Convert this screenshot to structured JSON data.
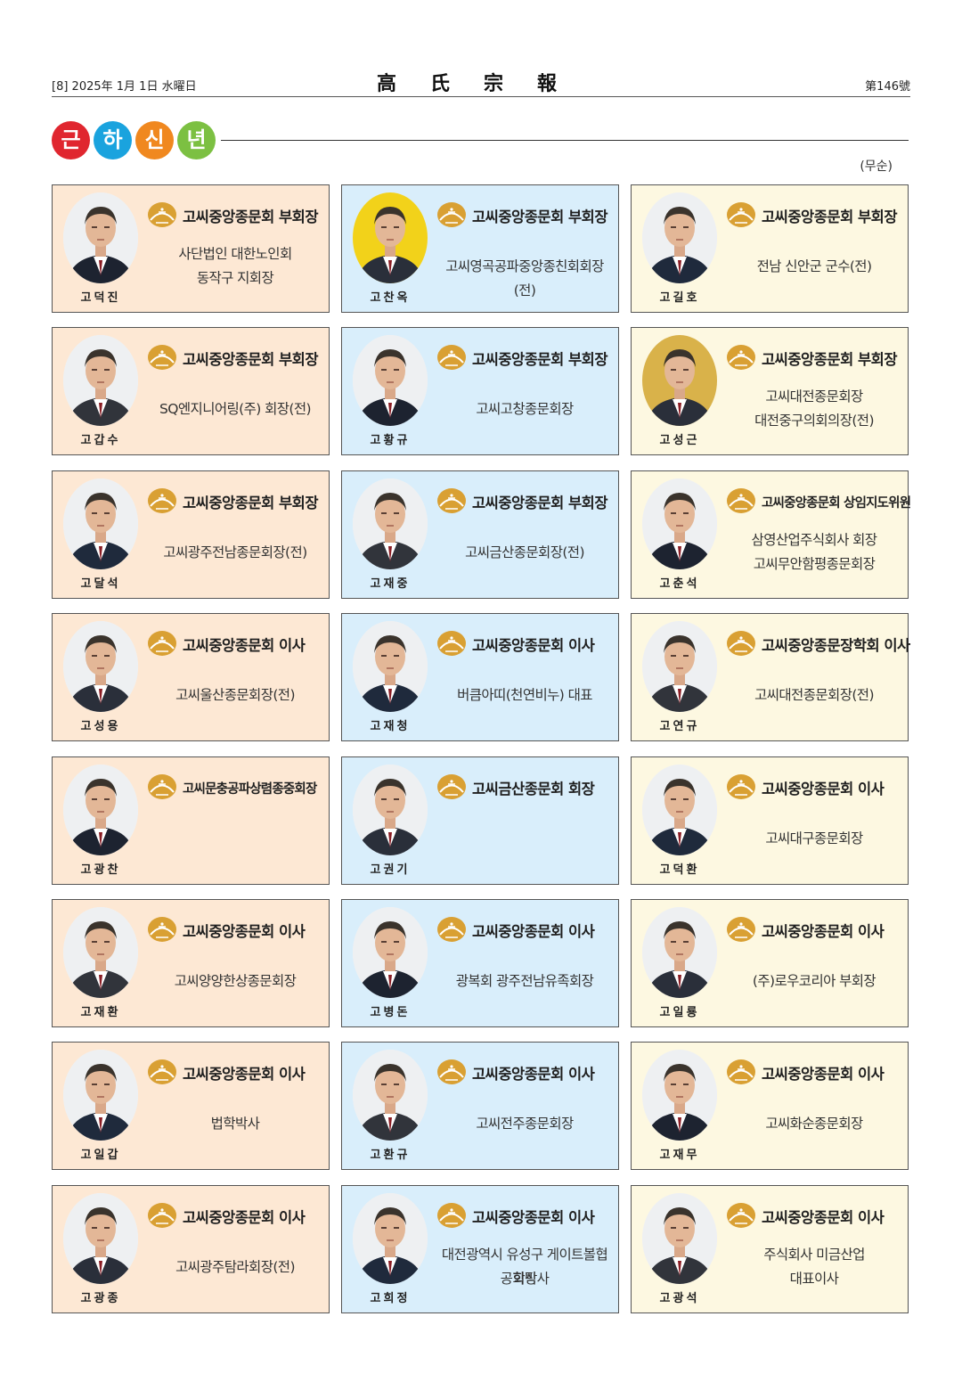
{
  "masthead": {
    "left": "[8]  2025年  1月  1日  水曜日",
    "center": "高氏宗報",
    "right": "第146號"
  },
  "section": {
    "title_chars": [
      {
        "char": "근",
        "color": "#e0262f"
      },
      {
        "char": "하",
        "color": "#1aa3de"
      },
      {
        "char": "신",
        "color": "#f0881f"
      },
      {
        "char": "년",
        "color": "#7cc042"
      }
    ],
    "order_note": "(무순)"
  },
  "colors": {
    "peach": "#fde8d4",
    "blue": "#d9eefb",
    "cream": "#fdf8e1",
    "logo_gold": "#d9a033"
  },
  "cards": [
    {
      "name": "고덕진",
      "title": "고씨중앙종문회 부회장",
      "lines": [
        "사단법인 대한노인회",
        "동작구 지회장"
      ],
      "bg": "peach",
      "title_small": false
    },
    {
      "name": "고찬옥",
      "title": "고씨중앙종문회 부회장",
      "lines": [
        "고씨영곡공파중앙종친회회장(전)"
      ],
      "bg": "blue",
      "title_small": false
    },
    {
      "name": "고길호",
      "title": "고씨중앙종문회 부회장",
      "lines": [
        "전남 신안군 군수(전)"
      ],
      "bg": "cream",
      "title_small": false
    },
    {
      "name": "고갑수",
      "title": "고씨중앙종문회 부회장",
      "lines": [
        "SQ엔지니어링(주) 회장(전)"
      ],
      "bg": "peach",
      "title_small": false
    },
    {
      "name": "고황규",
      "title": "고씨중앙종문회 부회장",
      "lines": [
        "고씨고창종문회장"
      ],
      "bg": "blue",
      "title_small": false
    },
    {
      "name": "고성근",
      "title": "고씨중앙종문회 부회장",
      "lines": [
        "고씨대전종문회장",
        "대전중구의회의장(전)"
      ],
      "bg": "cream",
      "title_small": false
    },
    {
      "name": "고달석",
      "title": "고씨중앙종문회 부회장",
      "lines": [
        "고씨광주전남종문회장(전)"
      ],
      "bg": "peach",
      "title_small": false
    },
    {
      "name": "고재중",
      "title": "고씨중앙종문회 부회장",
      "lines": [
        "고씨금산종문회장(전)"
      ],
      "bg": "blue",
      "title_small": false
    },
    {
      "name": "고춘석",
      "title": "고씨중앙종문회 상임지도위원",
      "lines": [
        "삼영산업주식회사 회장",
        "고씨무안함평종문회장"
      ],
      "bg": "cream",
      "title_small": true
    },
    {
      "name": "고성용",
      "title": "고씨중앙종문회 이사",
      "lines": [
        "고씨울산종문회장(전)"
      ],
      "bg": "peach",
      "title_small": false
    },
    {
      "name": "고재청",
      "title": "고씨중앙종문회 이사",
      "lines": [
        "버큼아띠(천연비누) 대표"
      ],
      "bg": "blue",
      "title_small": false
    },
    {
      "name": "고연규",
      "title": "고씨중앙종문장학회 이사",
      "lines": [
        "고씨대전종문회장(전)"
      ],
      "bg": "cream",
      "title_small": false
    },
    {
      "name": "고광찬",
      "title": "고씨문충공파상렴종중회장",
      "lines": [],
      "bg": "peach",
      "title_small": true
    },
    {
      "name": "고권기",
      "title": "고씨금산종문회 회장",
      "lines": [],
      "bg": "blue",
      "title_small": false
    },
    {
      "name": "고덕환",
      "title": "고씨중앙종문회 이사",
      "lines": [
        "고씨대구종문회장"
      ],
      "bg": "cream",
      "title_small": false
    },
    {
      "name": "고재환",
      "title": "고씨중앙종문회 이사",
      "lines": [
        "고씨양양한상종문회장"
      ],
      "bg": "peach",
      "title_small": false
    },
    {
      "name": "고병돈",
      "title": "고씨중앙종문회 이사",
      "lines": [
        "광복회 광주전남유족회장"
      ],
      "bg": "blue",
      "title_small": false
    },
    {
      "name": "고일룡",
      "title": "고씨중앙종문회 이사",
      "lines": [
        "(주)로우코리아 부회장"
      ],
      "bg": "cream",
      "title_small": false
    },
    {
      "name": "고일갑",
      "title": "고씨중앙종문회 이사",
      "lines": [
        "법학박사"
      ],
      "bg": "peach",
      "title_small": false
    },
    {
      "name": "고환규",
      "title": "고씨중앙종문회 이사",
      "lines": [
        "고씨전주종문회장"
      ],
      "bg": "blue",
      "title_small": false
    },
    {
      "name": "고재무",
      "title": "고씨중앙종문회 이사",
      "lines": [
        "고씨화순종문회장"
      ],
      "bg": "cream",
      "title_small": false
    },
    {
      "name": "고광종",
      "title": "고씨중앙종문회 이사",
      "lines": [
        "고씨광주탐라회장(전)"
      ],
      "bg": "peach",
      "title_small": false
    },
    {
      "name": "고희정",
      "title": "고씨중앙종문회 이사",
      "lines": [
        "대전광역시 유성구 게이트볼협회장",
        "공학박사"
      ],
      "bg": "blue",
      "title_small": false
    },
    {
      "name": "고광석",
      "title": "고씨중앙종문회 이사",
      "lines": [
        "주식회사 미금산업",
        "대표이사"
      ],
      "bg": "cream",
      "title_small": false
    }
  ]
}
